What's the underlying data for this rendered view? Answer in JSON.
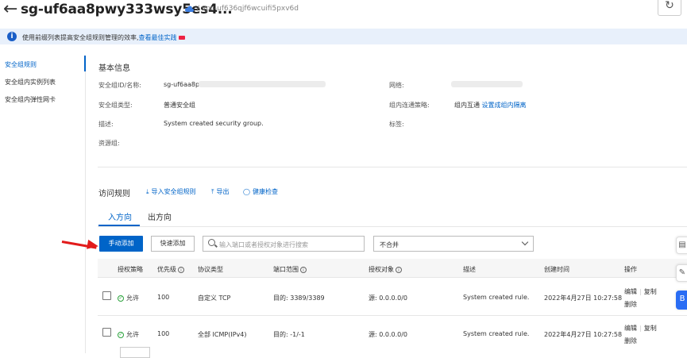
{
  "header": {
    "title": "sg-uf6aa8pwy333wsy5es4...",
    "vpc": "/ vpc-uf636qjf6wcuifi5pxv6d",
    "refresh_icon": "refresh-icon"
  },
  "banner": {
    "text": "使用前缀列表提高安全组规则管理的效率,",
    "link": "查看最佳实践"
  },
  "nav": {
    "items": [
      {
        "label": "安全组规则",
        "active": true
      },
      {
        "label": "安全组内实例列表"
      },
      {
        "label": "安全组内弹性网卡"
      }
    ]
  },
  "basic": {
    "title": "基本信息",
    "id_label": "安全组ID/名称:",
    "id_value": "sg-uf6aa8p",
    "type_label": "安全组类型:",
    "type_value": "普通安全组",
    "desc_label": "描述:",
    "desc_value": "System created security group.",
    "rg_label": "资源组:",
    "net_label": "网络:",
    "policy_label": "组内连通策略:",
    "policy_value": "组内互通",
    "policy_link": "设置成组内隔离",
    "tag_label": "标签:"
  },
  "rules": {
    "title": "访问规则",
    "import": "导入安全组规则",
    "export": "导出",
    "health": "健康检查",
    "tabs": [
      "入方向",
      "出方向"
    ],
    "manual_add": "手动添加",
    "quick_add": "快速添加",
    "search_placeholder": "输入端口或者授权对象进行搜索",
    "merge_select": "不合并"
  },
  "table": {
    "headers": [
      "授权策略",
      "优先级",
      "协议类型",
      "端口范围",
      "授权对象",
      "描述",
      "创建时间",
      "操作"
    ],
    "rows": [
      {
        "policy": "允许",
        "priority": "100",
        "protocol": "自定义 TCP",
        "port": "目的: 3389/3389",
        "source": "源: 0.0.0.0/0",
        "desc": "System created rule.",
        "time": "2022年4月27日 10:27:58",
        "edit": "编辑",
        "copy": "复制",
        "delete": "删除"
      },
      {
        "policy": "允许",
        "priority": "100",
        "protocol": "全部 ICMP(IPv4)",
        "port": "目的: -1/-1",
        "source": "源: 0.0.0.0/0",
        "desc": "System created rule.",
        "time": "2022年4月27日 10:27:58",
        "edit": "编辑",
        "copy": "复制",
        "delete": "删除"
      }
    ]
  },
  "colors": {
    "accent": "#0064c8",
    "annotation_arrow": "#e21b1b",
    "ok": "#2ba33c"
  }
}
